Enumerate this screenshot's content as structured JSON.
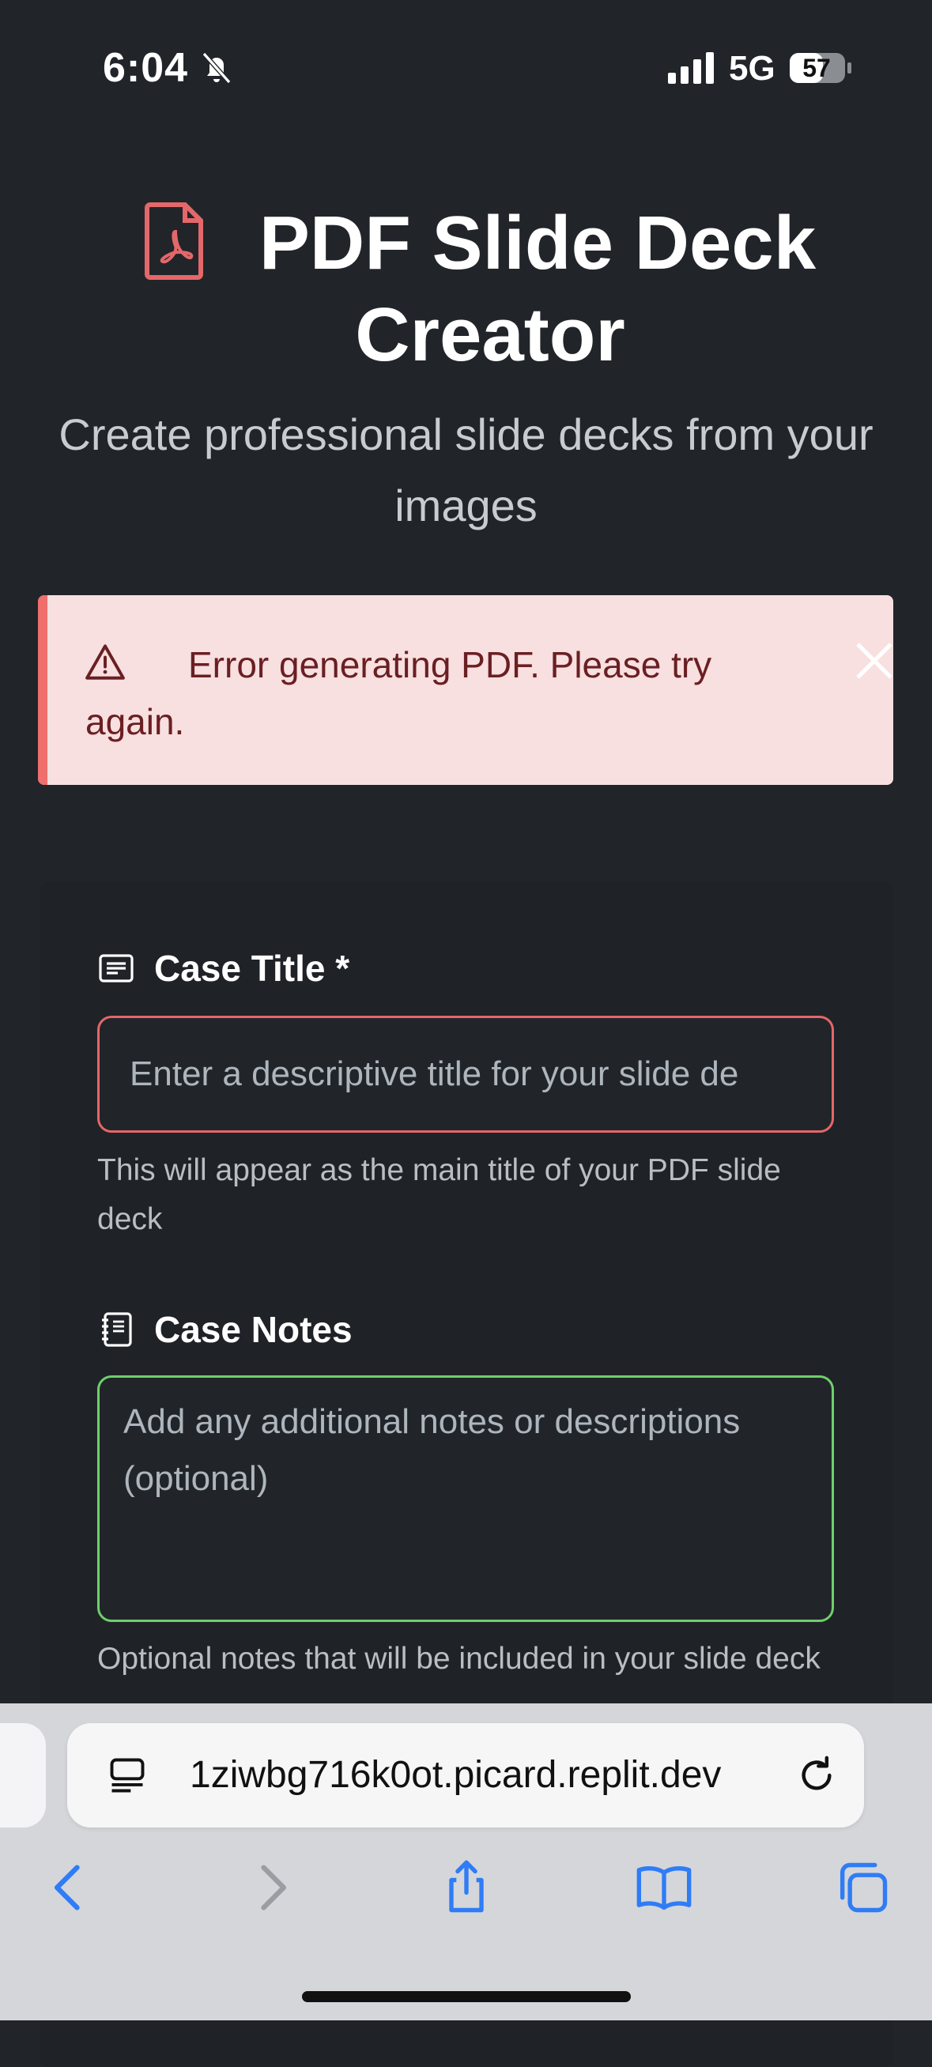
{
  "status_bar": {
    "time": "6:04",
    "network": "5G",
    "battery": "57"
  },
  "header": {
    "title_line1": "PDF Slide Deck",
    "title_line2": "Creator",
    "subtitle": "Create professional slide decks from your images"
  },
  "alert": {
    "message": "Error generating PDF. Please try again."
  },
  "form": {
    "case_title_label": "Case Title *",
    "case_title_placeholder": "Enter a descriptive title for your slide de",
    "case_title_help": "This will appear as the main title of your PDF slide deck",
    "case_notes_label": "Case Notes",
    "case_notes_placeholder": "Add any additional notes or descriptions (optional)",
    "case_notes_help": "Optional notes that will be included in your slide deck"
  },
  "browser": {
    "url": "1ziwbg716k0ot.picard.replit.dev"
  },
  "colors": {
    "background": "#212529",
    "alert_bg": "#f8dfe0",
    "alert_accent": "#ef6f6c",
    "invalid_border": "#e4676a",
    "valid_border": "#6fcf6b",
    "link_blue": "#2f7cf6"
  },
  "icons": [
    "silent-bell-icon",
    "signal-icon",
    "battery-icon",
    "pdf-file-icon",
    "warning-icon",
    "close-icon",
    "card-text-icon",
    "journal-icon",
    "page-menu-icon",
    "reload-icon",
    "back-icon",
    "forward-icon",
    "share-icon",
    "bookmarks-icon",
    "tabs-icon"
  ]
}
